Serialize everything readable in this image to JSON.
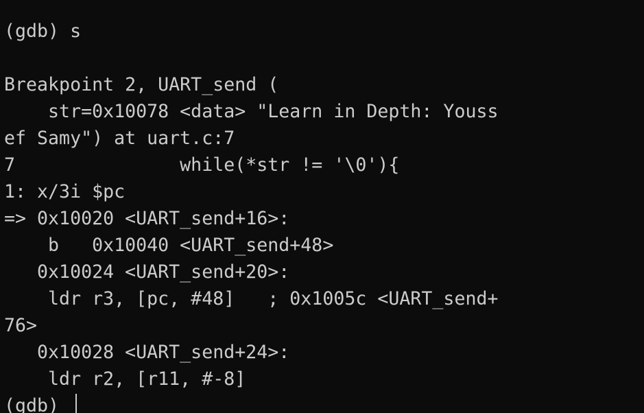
{
  "terminal": {
    "lines": [
      "                                        ",
      "(gdb) s",
      "",
      "Breakpoint 2, UART_send (",
      "    str=0x10078 <data> \"Learn in Depth: Youss",
      "ef Samy\") at uart.c:7",
      "7               while(*str != '\\0'){",
      "1: x/3i $pc",
      "=> 0x10020 <UART_send+16>:",
      "    b   0x10040 <UART_send+48>",
      "   0x10024 <UART_send+20>:",
      "    ldr r3, [pc, #48]   ; 0x1005c <UART_send+",
      "76>",
      "   0x10028 <UART_send+24>:",
      "    ldr r2, [r11, #-8]",
      "(gdb) "
    ]
  }
}
